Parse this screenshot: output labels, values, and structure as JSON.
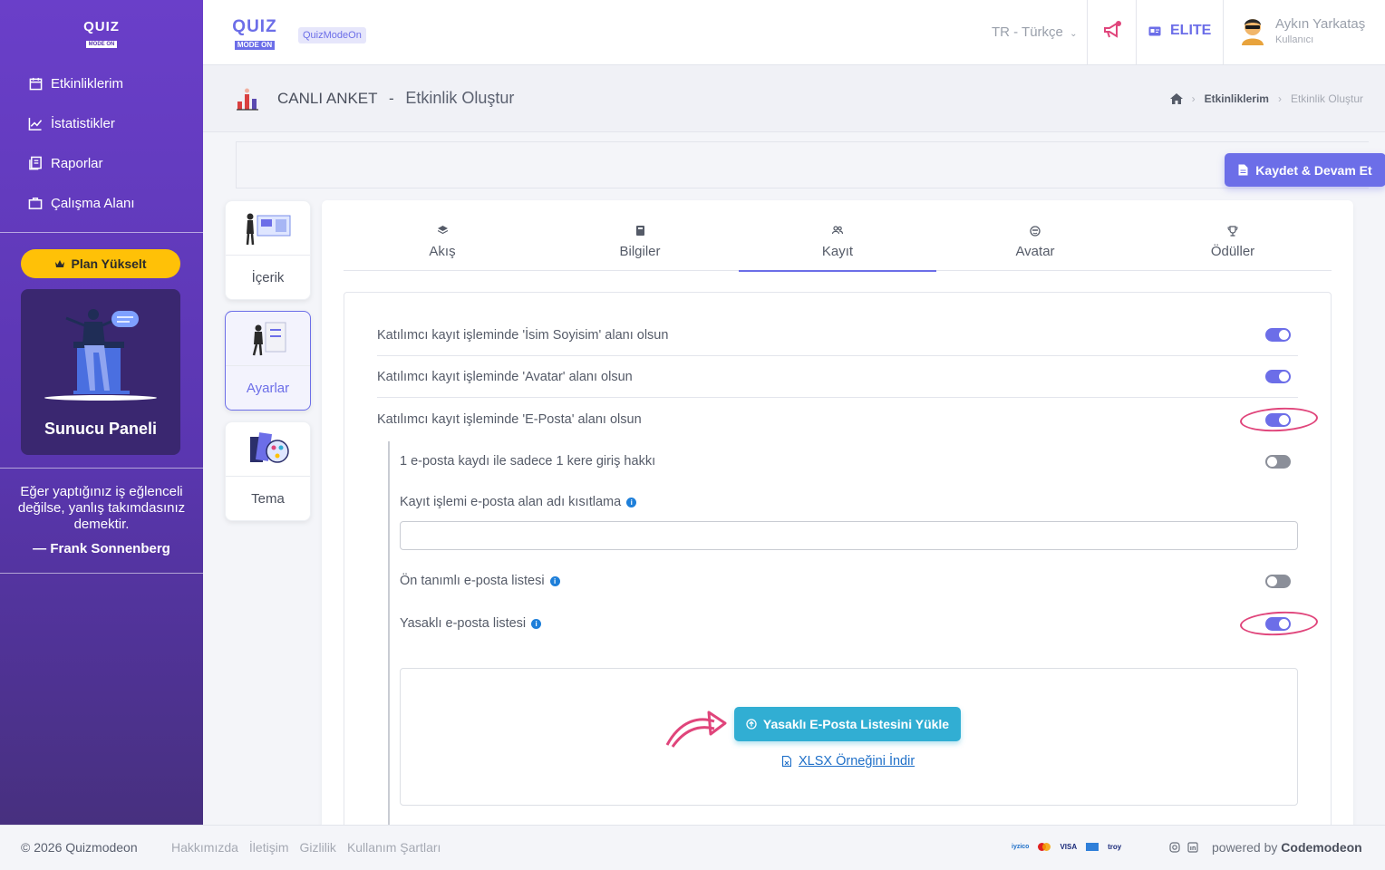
{
  "app": {
    "logo_top": "QUIZ",
    "logo_bottom": "MODE ON",
    "brand_badge": "QuizModeOn"
  },
  "sidebar": {
    "items": [
      {
        "label": "Etkinliklerim",
        "icon": "calendar-icon"
      },
      {
        "label": "İstatistikler",
        "icon": "chart-line-icon"
      },
      {
        "label": "Raporlar",
        "icon": "report-icon"
      },
      {
        "label": "Çalışma Alanı",
        "icon": "briefcase-icon"
      }
    ],
    "plan_button": "Plan Yükselt",
    "presenter_title": "Sunucu Paneli",
    "quote": "Eğer yaptığınız iş eğlenceli değilse, yanlış takımdasınız demektir.",
    "quote_author": "— Frank Sonnenberg"
  },
  "topbar": {
    "language": "TR - Türkçe",
    "plan_label": "ELITE",
    "user_name": "Aykın Yarkataş",
    "user_role": "Kullanıcı"
  },
  "page_header": {
    "activity_type": "CANLI ANKET",
    "separator": "-",
    "title": "Etkinlik Oluştur",
    "breadcrumb": [
      "Etkinliklerim",
      "Etkinlik Oluştur"
    ]
  },
  "actions": {
    "save_button": "Kaydet & Devam Et"
  },
  "steps": [
    {
      "label": "İçerik"
    },
    {
      "label": "Ayarlar",
      "active": true
    },
    {
      "label": "Tema"
    }
  ],
  "tabs": [
    {
      "label": "Akış",
      "icon": "layers-icon"
    },
    {
      "label": "Bilgiler",
      "icon": "book-icon"
    },
    {
      "label": "Kayıt",
      "icon": "users-icon",
      "active": true
    },
    {
      "label": "Avatar",
      "icon": "face-icon"
    },
    {
      "label": "Ödüller",
      "icon": "trophy-icon"
    }
  ],
  "registration": {
    "name_field": {
      "label": "Katılımcı kayıt işleminde 'İsim Soyisim' alanı olsun",
      "enabled": true
    },
    "avatar_field": {
      "label": "Katılımcı kayıt işleminde 'Avatar' alanı olsun",
      "enabled": true
    },
    "email_field": {
      "label": "Katılımcı kayıt işleminde 'E-Posta' alanı olsun",
      "enabled": true
    },
    "single_login": {
      "label": "1 e-posta kaydı ile sadece 1 kere giriş hakkı",
      "enabled": false
    },
    "domain_restrict": {
      "label": "Kayıt işlemi e-posta alan adı kısıtlama",
      "value": "",
      "placeholder": ""
    },
    "predefined_list": {
      "label": "Ön tanımlı e-posta listesi",
      "enabled": false
    },
    "banned_list": {
      "label": "Yasaklı e-posta listesi",
      "enabled": true
    },
    "upload_button": "Yasaklı E-Posta Listesini Yükle",
    "sample_link": "XLSX Örneğini İndir"
  },
  "footer": {
    "copyright": "© 2026 Quizmodeon",
    "links": [
      "Hakkımızda",
      "İletişim",
      "Gizlilik",
      "Kullanım Şartları"
    ],
    "payment": [
      "iyzico",
      "mastercard",
      "VISA",
      "amex",
      "troy"
    ],
    "powered_prefix": "powered by",
    "powered_brand": "Codemodeon"
  },
  "colors": {
    "sidebar": "#5a36b0",
    "accent": "#6c6ee8",
    "upload": "#31aed3",
    "plan": "#ffc107",
    "annotation": "#e0457b"
  }
}
